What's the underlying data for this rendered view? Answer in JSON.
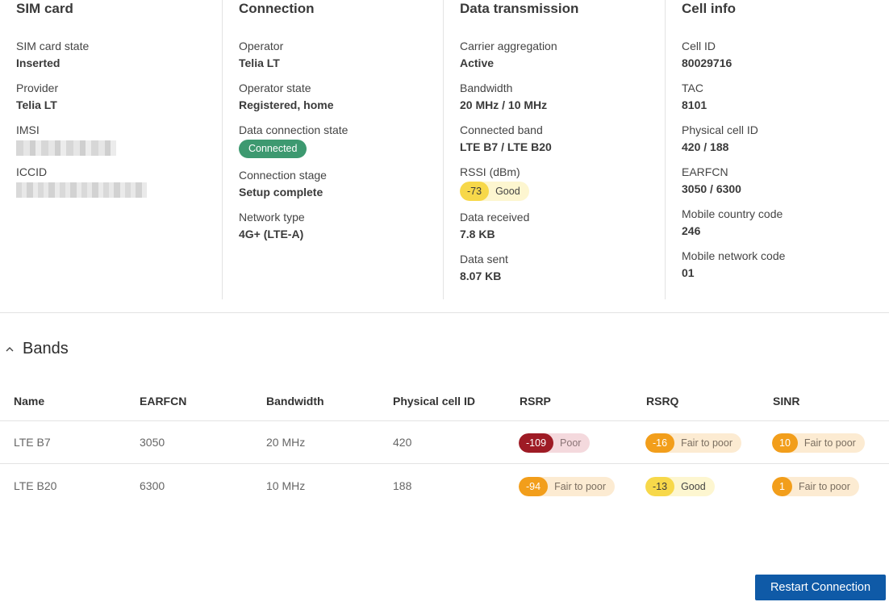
{
  "cards": {
    "sim": {
      "title": "SIM card",
      "state_label": "SIM card state",
      "state_value": "Inserted",
      "provider_label": "Provider",
      "provider_value": "Telia LT",
      "imsi_label": "IMSI",
      "iccid_label": "ICCID"
    },
    "connection": {
      "title": "Connection",
      "operator_label": "Operator",
      "operator_value": "Telia LT",
      "operator_state_label": "Operator state",
      "operator_state_value": "Registered, home",
      "data_state_label": "Data connection state",
      "data_state_value": "Connected",
      "stage_label": "Connection stage",
      "stage_value": "Setup complete",
      "network_label": "Network type",
      "network_value": "4G+ (LTE-A)"
    },
    "data": {
      "title": "Data transmission",
      "ca_label": "Carrier aggregation",
      "ca_value": "Active",
      "bw_label": "Bandwidth",
      "bw_value": "20 MHz / 10 MHz",
      "band_label": "Connected band",
      "band_value": "LTE B7 / LTE B20",
      "rssi_label": "RSSI (dBm)",
      "rssi_value": "-73",
      "rssi_quality": "Good",
      "rx_label": "Data received",
      "rx_value": "7.8 KB",
      "tx_label": "Data sent",
      "tx_value": "8.07 KB"
    },
    "cell": {
      "title": "Cell info",
      "cellid_label": "Cell ID",
      "cellid_value": "80029716",
      "tac_label": "TAC",
      "tac_value": "8101",
      "pci_label": "Physical cell ID",
      "pci_value": "420 / 188",
      "earfcn_label": "EARFCN",
      "earfcn_value": "3050 / 6300",
      "mcc_label": "Mobile country code",
      "mcc_value": "246",
      "mnc_label": "Mobile network code",
      "mnc_value": "01"
    }
  },
  "bands": {
    "title": "Bands",
    "columns": [
      "Name",
      "EARFCN",
      "Bandwidth",
      "Physical cell ID",
      "RSRP",
      "RSRQ",
      "SINR"
    ],
    "rows": [
      {
        "name": "LTE B7",
        "earfcn": "3050",
        "bandwidth": "20 MHz",
        "pci": "420",
        "rsrp": {
          "value": "-109",
          "quality": "Poor"
        },
        "rsrq": {
          "value": "-16",
          "quality": "Fair to poor"
        },
        "sinr": {
          "value": "10",
          "quality": "Fair to poor"
        }
      },
      {
        "name": "LTE B20",
        "earfcn": "6300",
        "bandwidth": "10 MHz",
        "pci": "188",
        "rsrp": {
          "value": "-94",
          "quality": "Fair to poor"
        },
        "rsrq": {
          "value": "-13",
          "quality": "Good"
        },
        "sinr": {
          "value": "1",
          "quality": "Fair to poor"
        }
      }
    ]
  },
  "restart_label": "Restart Connection",
  "colors": {
    "connected": "#3d9970",
    "good": "#f7d84a",
    "fair": "#f29e1b",
    "poor": "#9e1b25",
    "primary_button": "#0f5aa7"
  }
}
